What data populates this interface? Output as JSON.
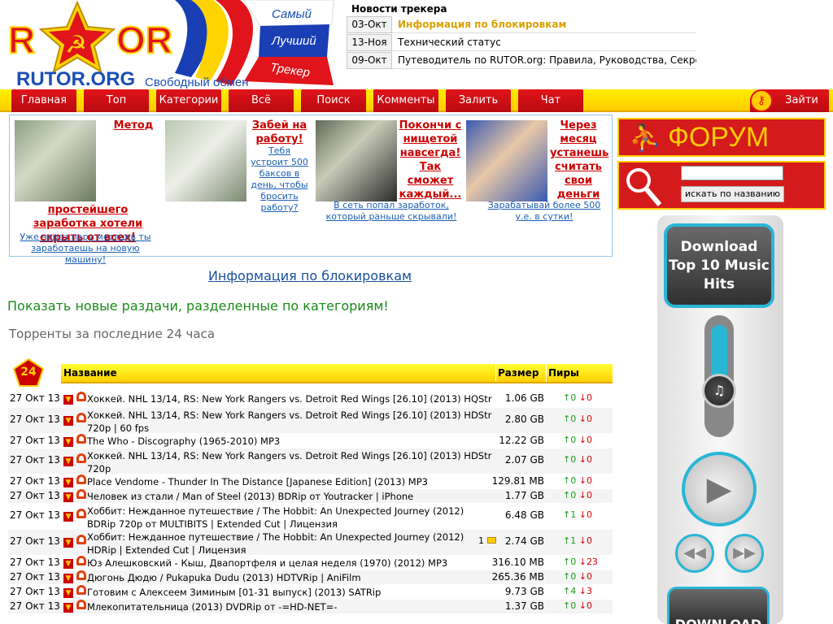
{
  "logo": {
    "main": "RUTOR.ORG",
    "slogan": "Свободный обмен",
    "banner": [
      "Самый",
      "Лучший",
      "Трекер"
    ]
  },
  "news": {
    "title": "Новости трекера",
    "items": [
      {
        "date": "03-Окт",
        "text": "Информация по блокировкам"
      },
      {
        "date": "13-Ноя",
        "text": "Технический статус"
      },
      {
        "date": "09-Окт",
        "text": "Путеводитель по RUTOR.org: Правила, Руководства, Секреты"
      }
    ]
  },
  "menu": [
    "Главная",
    "Топ",
    "Категории",
    "Всё",
    "Поиск",
    "Комменты",
    "Залить",
    "Чат"
  ],
  "login": "Зайти",
  "ads": [
    {
      "title": "Метод",
      "title2": "простейшего заработка хотели скрыть от всех!",
      "sub": "Уже через пару месяцев ты заработаешь на новую машину!"
    },
    {
      "title": "Забей на работу!",
      "sub": "Тебя устроит 500 баксов в день, чтобы бросить работу?"
    },
    {
      "title": "Покончи с нищетой навсегда! Так сможет каждый...",
      "sub": "В сеть попал заработок, который раньше скрывали!"
    },
    {
      "title": "Через месяц устанешь считать свои деньги",
      "sub": "Зарабатывай более 500 у.е. в сутки!"
    }
  ],
  "block_info": "Информация по блокировкам",
  "new_dist": "Показать новые раздачи, разделенные по категориям!",
  "last24": "Торренты за последние 24 часа",
  "badge": "24",
  "table": {
    "headers": {
      "name": "Название",
      "size": "Размер",
      "peers": "Пиры"
    },
    "rows": [
      {
        "date": "27 Окт 13",
        "name": "Хоккей. NHL 13/14, RS: New York Rangers vs. Detroit Red Wings [26.10] (2013) HQStr",
        "size": "1.06 GB",
        "up": "0",
        "down": "0",
        "comments": ""
      },
      {
        "date": "27 Окт 13",
        "name": "Хоккей. NHL 13/14, RS: New York Rangers vs. Detroit Red Wings [26.10] (2013) HDStr 720p | 60 fps",
        "size": "2.80 GB",
        "up": "0",
        "down": "0",
        "comments": ""
      },
      {
        "date": "27 Окт 13",
        "name": "The Who - Discography (1965-2010) MP3",
        "size": "12.22 GB",
        "up": "0",
        "down": "0",
        "comments": ""
      },
      {
        "date": "27 Окт 13",
        "name": "Хоккей. NHL 13/14, RS: New York Rangers vs. Detroit Red Wings [26.10] (2013) HDStr 720p",
        "size": "2.07 GB",
        "up": "0",
        "down": "0",
        "comments": ""
      },
      {
        "date": "27 Окт 13",
        "name": "Place Vendome - Thunder In The Distance [Japanese Edition] (2013) MP3",
        "size": "129.81 MB",
        "up": "0",
        "down": "0",
        "comments": ""
      },
      {
        "date": "27 Окт 13",
        "name": "Человек из стали / Man of Steel (2013) BDRip от Youtracker | iPhone",
        "size": "1.77 GB",
        "up": "0",
        "down": "0",
        "comments": ""
      },
      {
        "date": "27 Окт 13",
        "name": "Хоббит: Нежданное путешествие / The Hobbit: An Unexpected Journey (2012) BDRip 720p от MULTIBITS | Extended Cut | Лицензия",
        "size": "6.48 GB",
        "up": "1",
        "down": "0",
        "comments": ""
      },
      {
        "date": "27 Окт 13",
        "name": "Хоббит: Нежданное путешествие / The Hobbit: An Unexpected Journey (2012) HDRip | Extended Cut | Лицензия",
        "size": "2.74 GB",
        "up": "1",
        "down": "0",
        "comments": "1"
      },
      {
        "date": "27 Окт 13",
        "name": "Юз Алешковский - Кыш, Двапортфеля и целая неделя (1970) (2012) MP3",
        "size": "316.10 MB",
        "up": "0",
        "down": "23",
        "comments": ""
      },
      {
        "date": "27 Окт 13",
        "name": "Дюгонь Дюдю / Pukapuka Dudu (2013) HDTVRip | AniFilm",
        "size": "265.36 MB",
        "up": "0",
        "down": "0",
        "comments": ""
      },
      {
        "date": "27 Окт 13",
        "name": "Готовим с Алексеем Зиминым [01-31 выпуск] (2013) SATRip",
        "size": "9.73 GB",
        "up": "4",
        "down": "3",
        "comments": ""
      },
      {
        "date": "27 Окт 13",
        "name": "Млекопитательница (2013) DVDRip от -=HD-NET=-",
        "size": "1.37 GB",
        "up": "0",
        "down": "0",
        "comments": ""
      }
    ]
  },
  "forum": "ФОРУМ",
  "search_button": "искать по названию",
  "player": {
    "label": "Download Top 10 Music Hits",
    "bottom": "DOWNLOAD"
  }
}
